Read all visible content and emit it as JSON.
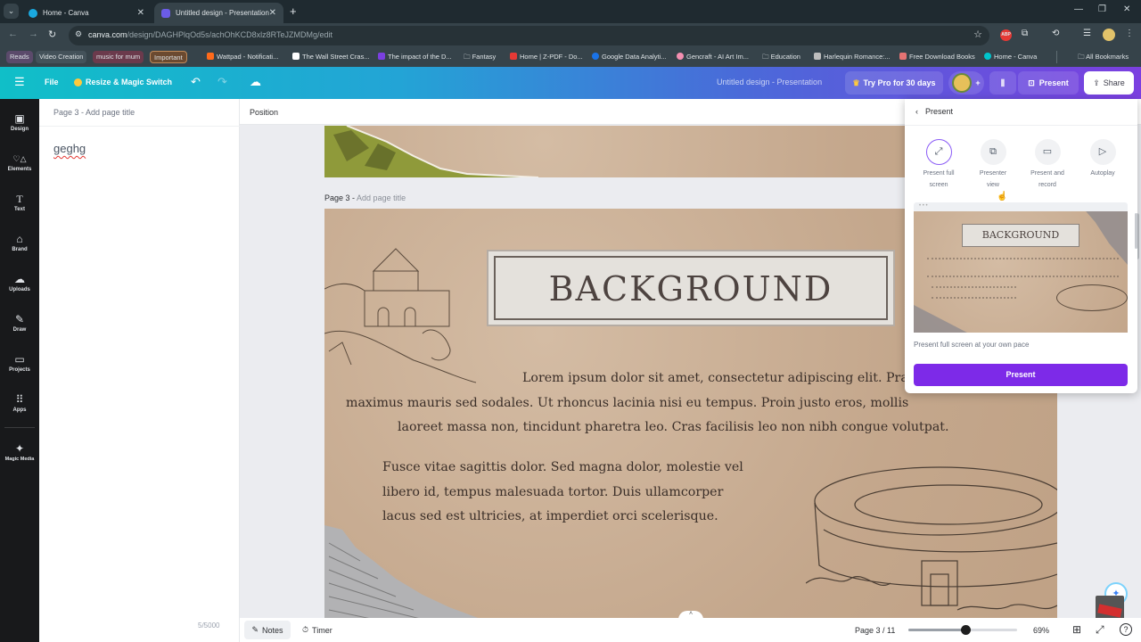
{
  "browser": {
    "tabs": [
      {
        "title": "Home - Canva",
        "active": false
      },
      {
        "title": "Untitled design - Presentation",
        "active": true
      }
    ],
    "url_host": "canva.com",
    "url_path": "/design/DAGHPlqOd5s/achOhKCD8xlz8RTeJZMDMg/edit",
    "bookmarks": [
      {
        "label": "Reads",
        "type": "tag",
        "color": "#5b4a6b"
      },
      {
        "label": "Video Creation",
        "type": "tag",
        "color": "#44525a"
      },
      {
        "label": "music for mum",
        "type": "tag",
        "color": "#6b3a4c"
      },
      {
        "label": "Important",
        "type": "tag",
        "color": "#6b4a30"
      },
      {
        "label": "Wattpad - Notificati...",
        "type": "link",
        "color": "#ff6a1a"
      },
      {
        "label": "The Wall Street Cras...",
        "type": "link",
        "color": "#ffffff"
      },
      {
        "label": "The impact of the D...",
        "type": "link",
        "color": "#7b3fe0"
      },
      {
        "label": "Fantasy",
        "type": "folder",
        "color": "#dfe4e7"
      },
      {
        "label": "Home | Z-PDF - Do...",
        "type": "link",
        "color": "#e53935"
      },
      {
        "label": "Google Data Analyti...",
        "type": "link",
        "color": "#1a73e8"
      },
      {
        "label": "Gencraft - AI Art Im...",
        "type": "link",
        "color": "#f48fb1"
      },
      {
        "label": "Education",
        "type": "folder",
        "color": "#dfe4e7"
      },
      {
        "label": "Harlequin Romance:...",
        "type": "link",
        "color": "#bdbdbd"
      },
      {
        "label": "Free Download Books",
        "type": "link",
        "color": "#e57373"
      },
      {
        "label": "Home - Canva",
        "type": "link",
        "color": "#00c4cc"
      }
    ],
    "all_bookmarks": "All Bookmarks"
  },
  "header": {
    "file": "File",
    "resize": "Resize & Magic Switch",
    "doc_title": "Untitled design - Presentation",
    "try_pro": "Try Pro for 30 days",
    "present": "Present",
    "share": "Share"
  },
  "rail": [
    {
      "label": "Design",
      "icon": "▣"
    },
    {
      "label": "Elements",
      "icon": "♡△"
    },
    {
      "label": "Text",
      "icon": "T"
    },
    {
      "label": "Brand",
      "icon": "⌂"
    },
    {
      "label": "Uploads",
      "icon": "☁"
    },
    {
      "label": "Draw",
      "icon": "✎"
    },
    {
      "label": "Projects",
      "icon": "▭"
    },
    {
      "label": "Apps",
      "icon": "⠿"
    },
    {
      "label": "Magic Media",
      "icon": "✦"
    }
  ],
  "notes": {
    "page_label": "Page 3",
    "title_placeholder": "Add page title",
    "text": "geghg",
    "char_count": "5/5000"
  },
  "canvas": {
    "toolbar_label": "Position",
    "page_label": "Page 3",
    "title_placeholder": "Add page title",
    "slide": {
      "title": "BACKGROUND",
      "para1": "Lorem ipsum dolor sit amet, consectetur adipiscing elit. Praesent maximus mauris sed sodales. Ut rhoncus lacinia nisi eu tempus. Proin justo eros, mollis laoreet massa non, tincidunt pharetra leo. Cras facilisis leo non nibh congue volutpat.",
      "para1_lines": [
        "Lorem ipsum dolor sit amet, consectetur adipiscing elit. Praesent",
        "maximus mauris sed sodales. Ut rhoncus lacinia nisi eu tempus. Proin justo eros, mollis",
        "laoreet massa non, tincidunt pharetra leo. Cras facilisis leo non nibh congue volutpat."
      ],
      "para2_lines": [
        "Fusce vitae sagittis dolor. Sed magna dolor, molestie vel",
        "libero id, tempus malesuada tortor. Duis ullamcorper",
        "lacus sed est ultricies, at imperdiet orci scelerisque."
      ]
    }
  },
  "present_panel": {
    "title": "Present",
    "options": [
      {
        "line1": "Present full",
        "line2": "screen",
        "icon": "⤢",
        "selected": true
      },
      {
        "line1": "Presenter",
        "line2": "view",
        "icon": "⧉",
        "selected": false
      },
      {
        "line1": "Present and",
        "line2": "record",
        "icon": "▭",
        "selected": false
      },
      {
        "line1": "Autoplay",
        "line2": "",
        "icon": "▷",
        "selected": false
      }
    ],
    "preview_title": "BACKGROUND",
    "description": "Present full screen at your own pace",
    "button": "Present",
    "accent": "#7d2ae8"
  },
  "bottom_bar": {
    "notes": "Notes",
    "timer": "Timer",
    "page_indicator": "Page 3 / 11",
    "zoom_percent": 69,
    "zoom_label": "69%"
  }
}
